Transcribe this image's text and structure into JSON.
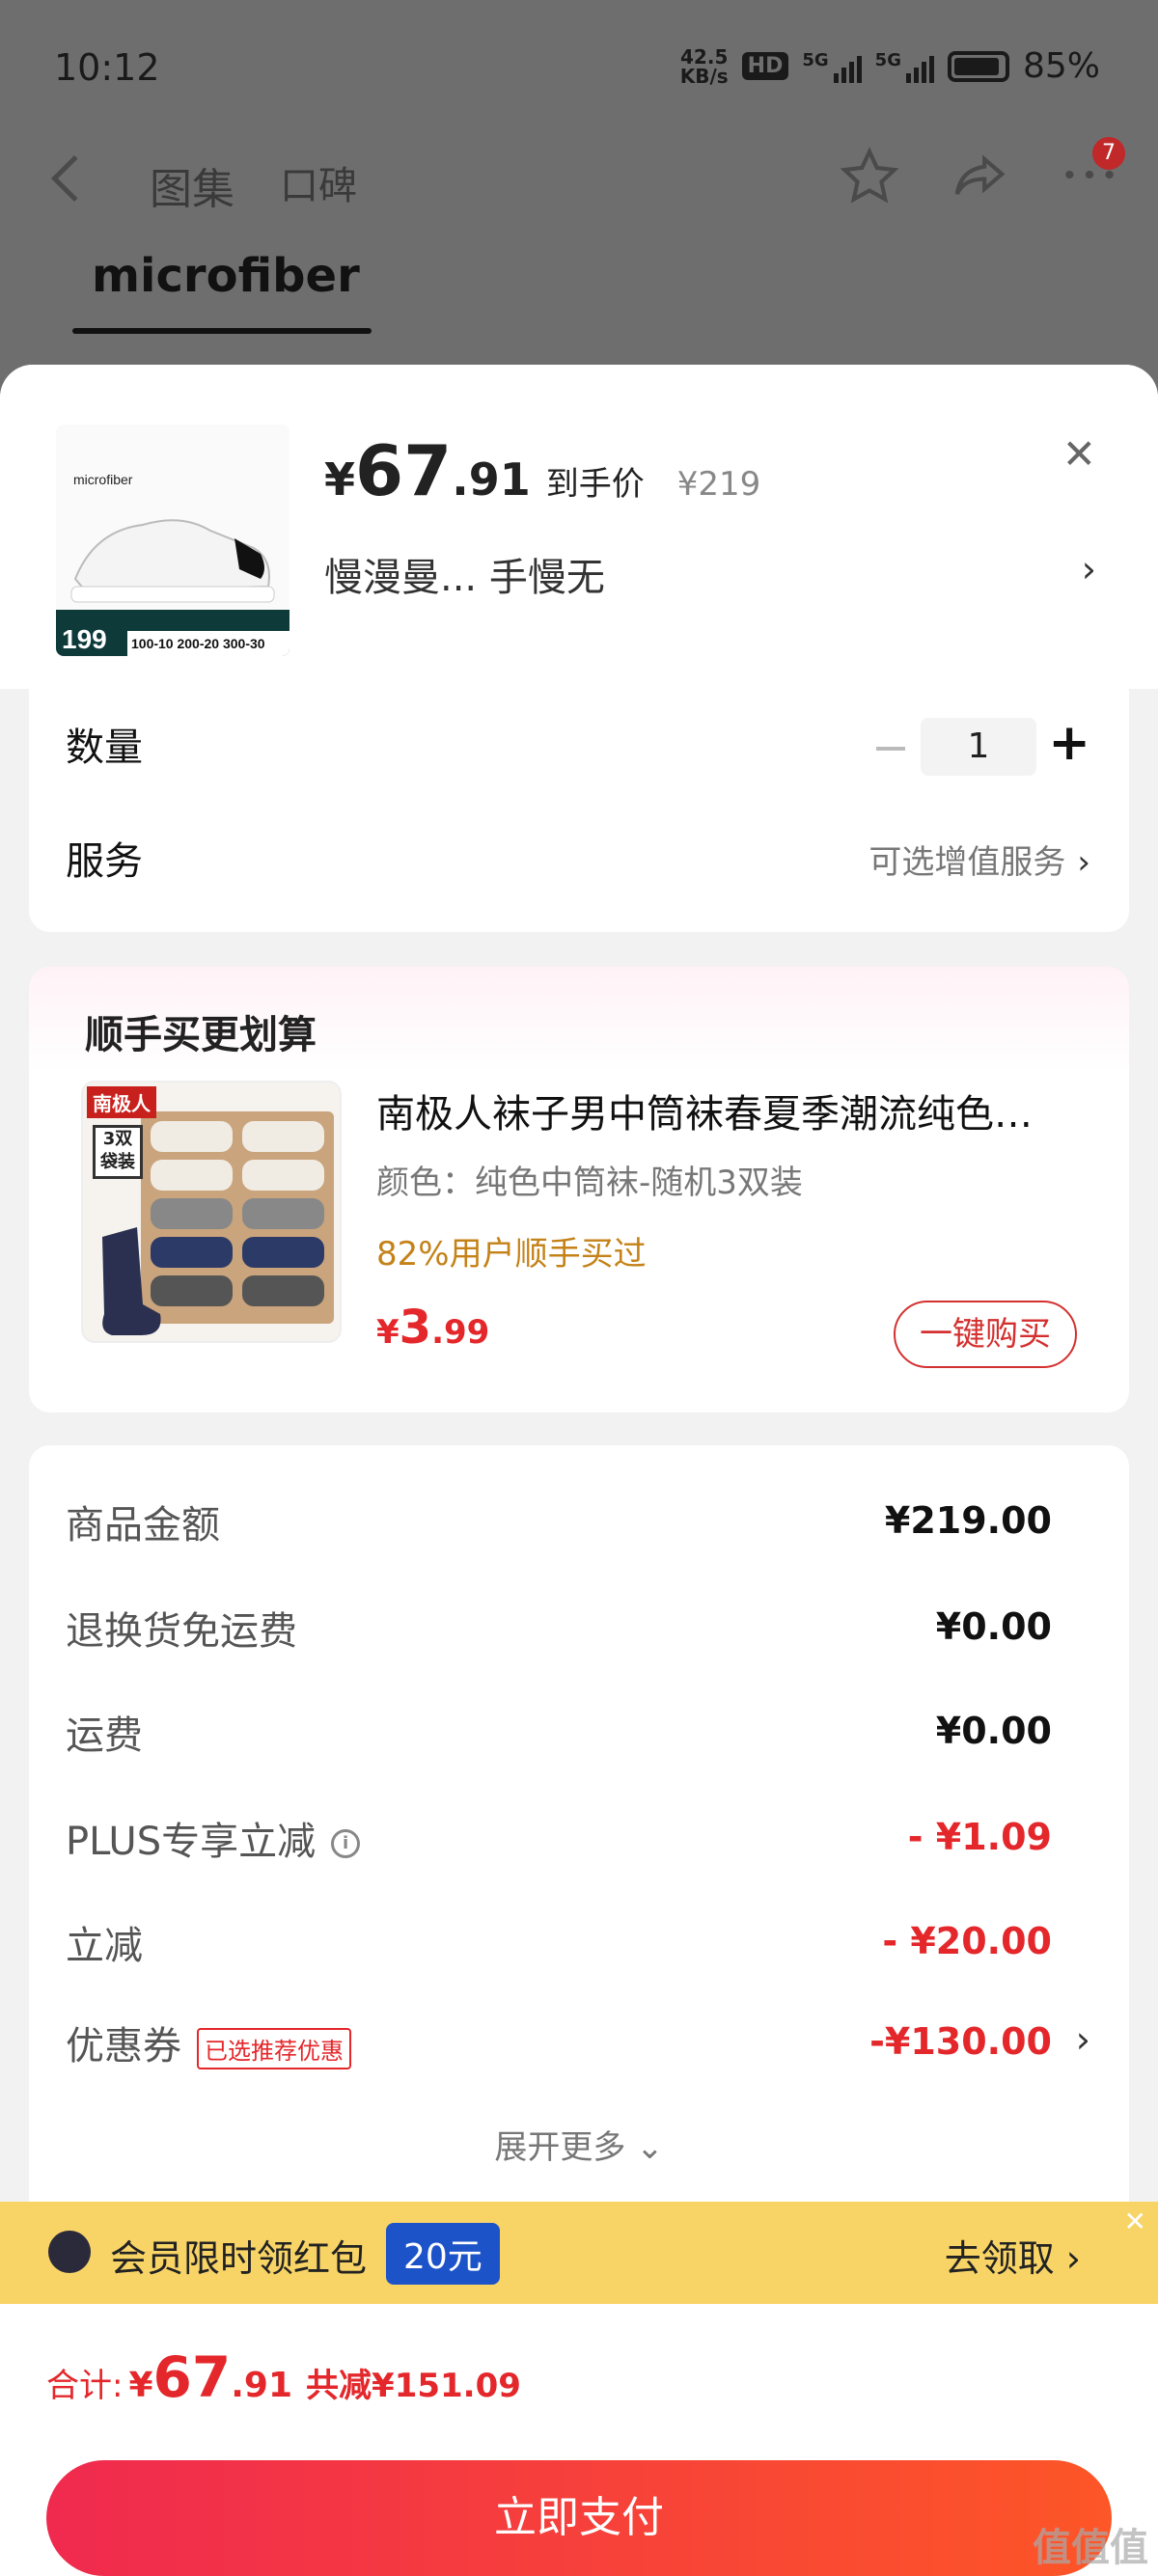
{
  "status": {
    "time": "10:12",
    "net_speed": "42.5",
    "net_unit": "KB/s",
    "hd": "HD",
    "sig1": "5G",
    "sig2": "5G",
    "battery": "85%"
  },
  "nav": {
    "tab1": "图集",
    "tab2": "口碑",
    "badge": "7"
  },
  "bg": {
    "title": "microfiber"
  },
  "product": {
    "thumb_text": "microfiber",
    "thumb_price": "199",
    "thumb_promo": "100-10 200-20 300-30",
    "yen": "¥",
    "price_int": "67",
    "price_dec": ".91",
    "price_label": "到手价",
    "orig_price": "¥219",
    "shop": "慢漫曼...  手慢无"
  },
  "options": {
    "qty_label": "数量",
    "qty_value": "1",
    "service_label": "服务",
    "service_value": "可选增值服务"
  },
  "recommend": {
    "title": "顺手买更划算",
    "brand": "南极人",
    "pack": "3双袋装",
    "name": "南极人袜子男中筒袜春夏季潮流纯色…",
    "color": "颜色：纯色中筒袜-随机3双装",
    "hint": "82%用户顺手买过",
    "price_yen": "¥",
    "price_int": "3",
    "price_dec": ".99",
    "button": "一键购买"
  },
  "fees": [
    {
      "label": "商品金额",
      "value": "¥219.00"
    },
    {
      "label": "退换货免运费",
      "value": "¥0.00"
    },
    {
      "label": "运费",
      "value": "¥0.00"
    },
    {
      "label": "PLUS专享立减",
      "value": "- ¥1.09"
    },
    {
      "label": "立减",
      "value": "- ¥20.00"
    },
    {
      "label": "优惠券",
      "value": "-¥130.00",
      "tag": "已选推荐优惠"
    }
  ],
  "expand": "展开更多 ⌄",
  "member": {
    "text": "会员限时领红包",
    "tag": "20元",
    "go": "去领取 ›"
  },
  "footer": {
    "total_label": "合计:",
    "yen": "¥",
    "int": "67",
    "dec": ".91",
    "save": "共减¥151.09",
    "pay": "立即支付"
  },
  "watermark": "值值值",
  "colors": {
    "accent": "#e4272b",
    "member_bg": "#f8d467",
    "pay_gradient": "#f02a4f"
  }
}
